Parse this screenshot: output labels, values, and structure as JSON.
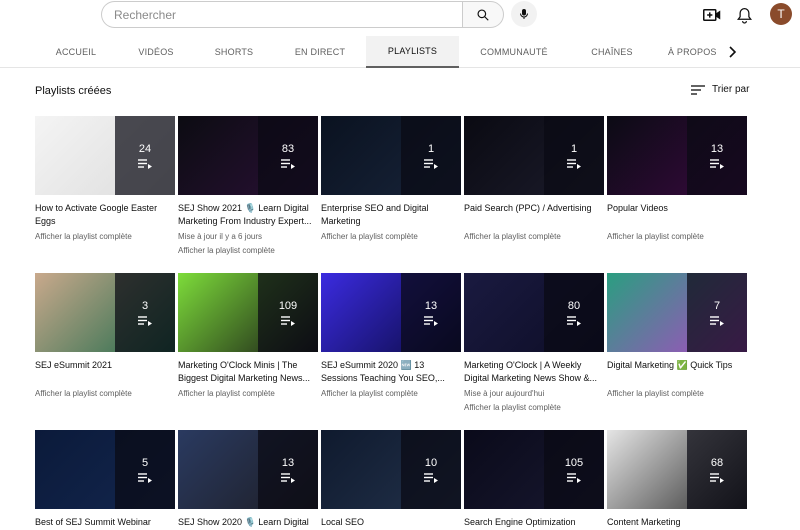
{
  "search": {
    "placeholder": "Rechercher"
  },
  "avatar": {
    "letter": "T"
  },
  "tabs": [
    {
      "label": "ACCUEIL",
      "active": false
    },
    {
      "label": "VIDÉOS",
      "active": false
    },
    {
      "label": "SHORTS",
      "active": false
    },
    {
      "label": "EN DIRECT",
      "active": false
    },
    {
      "label": "PLAYLISTS",
      "active": true
    },
    {
      "label": "COMMUNAUTÉ",
      "active": false
    },
    {
      "label": "CHAÎNES",
      "active": false
    },
    {
      "label": "À PROPOS",
      "active": false
    }
  ],
  "section": {
    "title": "Playlists créées",
    "sort_label": "Trier par"
  },
  "playlists": [
    {
      "title": "How to Activate Google Easter Eggs",
      "count": "24",
      "meta": "",
      "link": "Afficher la playlist complète",
      "colors": [
        "#f4f4f4",
        "#dcdcdc"
      ]
    },
    {
      "title": "SEJ Show 2021 🎙️ Learn Digital Marketing From Industry Expert...",
      "count": "83",
      "meta": "Mise à jour il y a 6 jours",
      "link": "Afficher la playlist complète",
      "colors": [
        "#0c0c12",
        "#2a1036"
      ]
    },
    {
      "title": "Enterprise SEO and Digital Marketing",
      "count": "1",
      "meta": "",
      "link": "Afficher la playlist complète",
      "colors": [
        "#0a1220",
        "#18243a"
      ]
    },
    {
      "title": "Paid Search (PPC) / Advertising",
      "count": "1",
      "meta": "",
      "link": "Afficher la playlist complète",
      "colors": [
        "#0a0a12",
        "#1c1c2c"
      ]
    },
    {
      "title": "Popular Videos",
      "count": "13",
      "meta": "",
      "link": "Afficher la playlist complète",
      "colors": [
        "#0b0b14",
        "#3a0a40"
      ]
    },
    {
      "title": "SEJ eSummit 2021",
      "count": "3",
      "meta": "",
      "link": "Afficher la playlist complète",
      "colors": [
        "#c9a98c",
        "#1f6a4a"
      ]
    },
    {
      "title": "Marketing O'Clock Minis | The Biggest Digital Marketing News...",
      "count": "109",
      "meta": "",
      "link": "Afficher la playlist complète",
      "colors": [
        "#7ddc3a",
        "#161616"
      ]
    },
    {
      "title": "SEJ eSummit 2020 🆕 13 Sessions Teaching You SEO,...",
      "count": "13",
      "meta": "",
      "link": "Afficher la playlist complète",
      "colors": [
        "#3b2be0",
        "#0a0a40"
      ]
    },
    {
      "title": "Marketing O'Clock | A Weekly Digital Marketing News Show &...",
      "count": "80",
      "meta": "Mise à jour aujourd'hui",
      "link": "Afficher la playlist complète",
      "colors": [
        "#1a1a40",
        "#0d0d26"
      ]
    },
    {
      "title": "Digital Marketing ✅ Quick Tips",
      "count": "7",
      "meta": "",
      "link": "Afficher la playlist complète",
      "colors": [
        "#2a9e80",
        "#b045c6"
      ]
    },
    {
      "title": "Best of SEJ Summit Webinar",
      "count": "5",
      "meta": "",
      "link": "",
      "colors": [
        "#0b1a3a",
        "#13264e"
      ]
    },
    {
      "title": "SEJ Show 2020 🎙️ Learn Digital",
      "count": "13",
      "meta": "",
      "link": "",
      "colors": [
        "#2a3a60",
        "#1d1d24"
      ]
    },
    {
      "title": "Local SEO",
      "count": "10",
      "meta": "",
      "link": "",
      "colors": [
        "#0f1a2e",
        "#22314a"
      ]
    },
    {
      "title": "Search Engine Optimization",
      "count": "105",
      "meta": "",
      "link": "",
      "colors": [
        "#0a0a1a",
        "#181830"
      ]
    },
    {
      "title": "Content Marketing",
      "count": "68",
      "meta": "",
      "link": "",
      "colors": [
        "#e5e5e5",
        "#2a2a2a"
      ]
    }
  ]
}
